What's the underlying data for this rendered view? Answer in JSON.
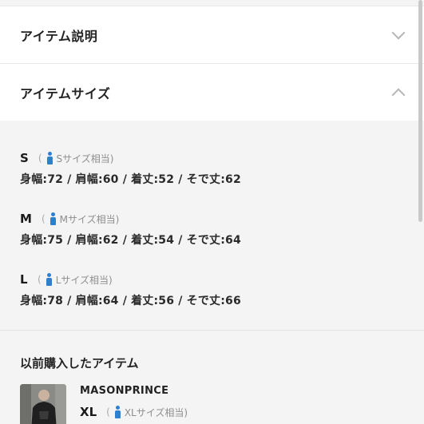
{
  "accordions": {
    "description": {
      "title": "アイテム説明",
      "state": "collapsed"
    },
    "size": {
      "title": "アイテムサイズ",
      "state": "expanded"
    }
  },
  "sizes": [
    {
      "label": "S",
      "paren_open": "(",
      "note": "Sサイズ相当)",
      "measurements": "身幅:72 / 肩幅:60 / 着丈:52 / そで丈:62"
    },
    {
      "label": "M",
      "paren_open": "(",
      "note": "Mサイズ相当)",
      "measurements": "身幅:75 / 肩幅:62 / 着丈:54 / そで丈:64"
    },
    {
      "label": "L",
      "paren_open": "(",
      "note": "Lサイズ相当)",
      "measurements": "身幅:78 / 肩幅:64 / 着丈:56 / そで丈:66"
    }
  ],
  "past_purchase": {
    "title": "以前購入したアイテム",
    "brand": "MASONPRINCE",
    "size_label": "XL",
    "paren_open": "(",
    "size_note": "XLサイズ相当)"
  },
  "colors": {
    "icon_blue": "#2d7fd0",
    "chevron": "#b5b5b5",
    "background": "#f4f4f4"
  }
}
